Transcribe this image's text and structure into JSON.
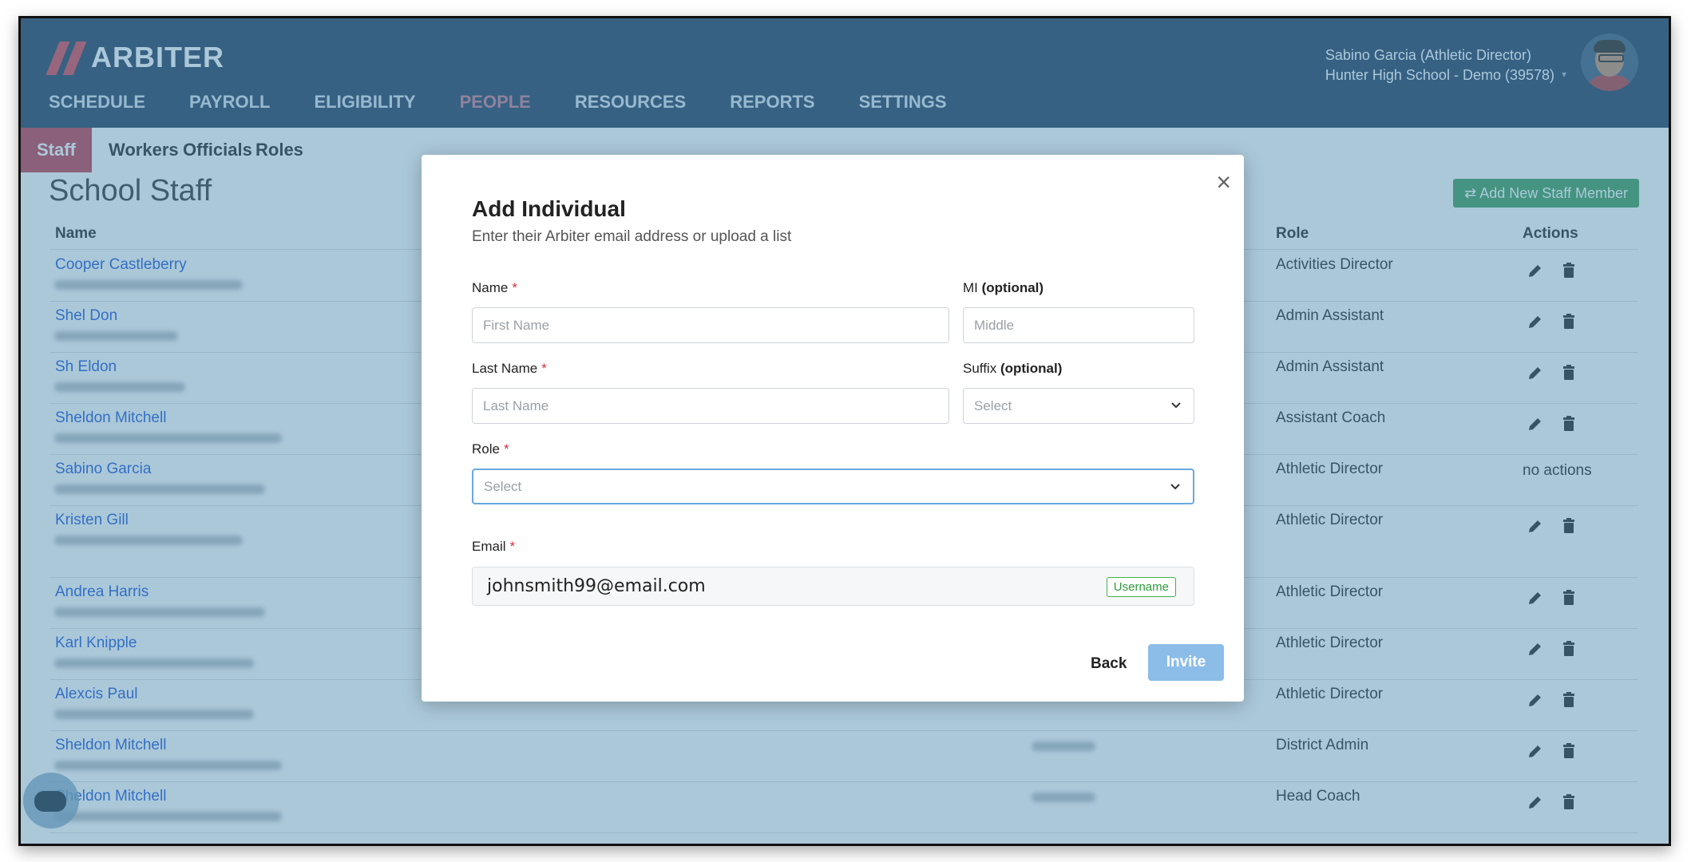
{
  "app": {
    "logo_text": "ARBITER",
    "nav": [
      "SCHEDULE",
      "PAYROLL",
      "ELIGIBILITY",
      "PEOPLE",
      "RESOURCES",
      "REPORTS",
      "SETTINGS"
    ],
    "active_nav": "PEOPLE",
    "user_line1": "Sabino Garcia (Athletic Director)",
    "user_line2": "Hunter High School - Demo (39578)"
  },
  "subtabs": [
    "Staff",
    "Workers",
    "Officials",
    "Roles"
  ],
  "page": {
    "title": "School Staff",
    "add_button": "Add New Staff Member",
    "columns": {
      "name": "Name",
      "role": "Role",
      "actions": "Actions"
    },
    "rows": [
      {
        "name": "Cooper Castleberry",
        "role": "Activities Director",
        "actions": ""
      },
      {
        "name": "Shel Don",
        "role": "Admin Assistant",
        "actions": ""
      },
      {
        "name": "Sh Eldon",
        "role": "Admin Assistant",
        "actions": ""
      },
      {
        "name": "Sheldon Mitchell",
        "role": "Assistant Coach",
        "actions": ""
      },
      {
        "name": "Sabino Garcia",
        "role": "Athletic Director",
        "actions": "no actions"
      },
      {
        "name": "Kristen Gill",
        "role": "Athletic Director",
        "actions": ""
      },
      {
        "name": "Andrea Harris",
        "role": "Athletic Director",
        "actions": ""
      },
      {
        "name": "Karl Knipple",
        "role": "Athletic Director",
        "actions": ""
      },
      {
        "name": "Alexcis Paul",
        "role": "Athletic Director",
        "actions": ""
      },
      {
        "name": "Sheldon Mitchell",
        "role": "District Admin",
        "actions": ""
      },
      {
        "name": "Sheldon Mitchell",
        "role": "Head Coach",
        "actions": ""
      }
    ]
  },
  "modal": {
    "close": "×",
    "title": "Add Individual",
    "subtitle": "Enter their Arbiter email address or upload a list",
    "name_label": "Name",
    "first_placeholder": "First Name",
    "mi_label": "MI",
    "mi_optional": "(optional)",
    "mi_placeholder": "Middle",
    "last_label": "Last Name",
    "last_placeholder": "Last Name",
    "suffix_label": "Suffix",
    "suffix_optional": "(optional)",
    "suffix_value": "Select",
    "role_label": "Role",
    "role_value": "Select",
    "email_label": "Email",
    "email_value": "johnsmith99@email.com",
    "username_badge": "Username",
    "required_mark": "*",
    "back": "Back",
    "invite": "Invite"
  },
  "colors": {
    "header": "#1f3a5b",
    "accent_red": "#c0394a",
    "link_blue": "#1a55d6",
    "add_green": "#3b9b57",
    "invite_blue": "#8cbde8"
  }
}
